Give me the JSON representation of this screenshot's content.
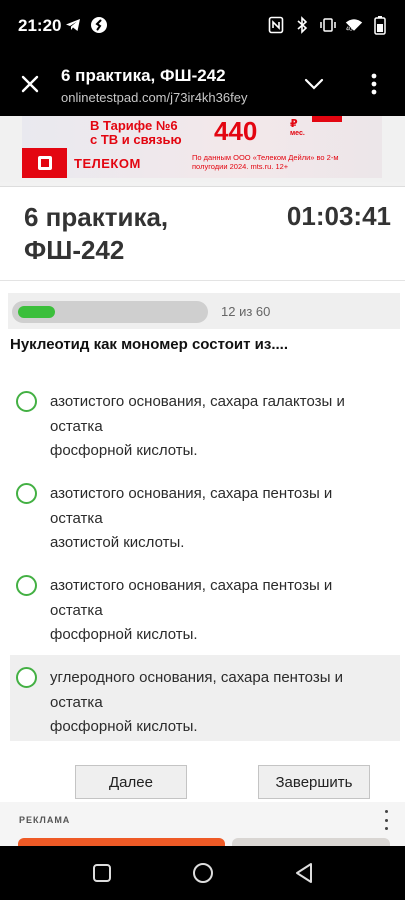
{
  "status_bar": {
    "time": "21:20",
    "left_icons": [
      "telegram-icon",
      "shazam-icon"
    ],
    "right_icons": [
      "nfc-icon",
      "bluetooth-icon",
      "vibrate-icon",
      "wifi-icon",
      "battery-icon"
    ]
  },
  "tab": {
    "title": "6 практика, ФШ-242",
    "url": "onlinetestpad.com/j73ir4kh36fey"
  },
  "ad_banner": {
    "tariff_line1": "В Тарифе №6",
    "tariff_line2": "с ТВ и связью",
    "price": "440",
    "currency": "₽",
    "period": "мес.",
    "brand": "ТЕЛЕКОМ",
    "fine_print": "По данным ООО «Телеком Дейли» во 2-м полугодии 2024. mts.ru. 12+",
    "brand_color": "#e30611"
  },
  "test": {
    "title": "6 практика, ФШ-242",
    "timer": "01:03:41",
    "progress_label": "12 из 60",
    "progress_fraction": 0.2,
    "question": "Нуклеотид как мономер состоит из....",
    "answers": [
      {
        "lines": [
          "азотистого основания, сахара галактозы и",
          "остатка",
          "фосфорной кислоты."
        ],
        "selected": false
      },
      {
        "lines": [
          "азотистого основания, сахара пентозы и",
          "остатка",
          "азотистой кислоты."
        ],
        "selected": false
      },
      {
        "lines": [
          "азотистого основания, сахара пентозы и",
          "остатка",
          "фосфорной кислоты."
        ],
        "selected": false
      },
      {
        "lines": [
          "углеродного основания, сахара пентозы и",
          "остатка",
          "фосфорной кислоты."
        ],
        "selected": false
      }
    ],
    "prev_button": "Далее",
    "finish_button": "Завершить",
    "accent_color": "#3bbf3b"
  },
  "ad_footer": {
    "label": "РЕКЛАМА"
  }
}
